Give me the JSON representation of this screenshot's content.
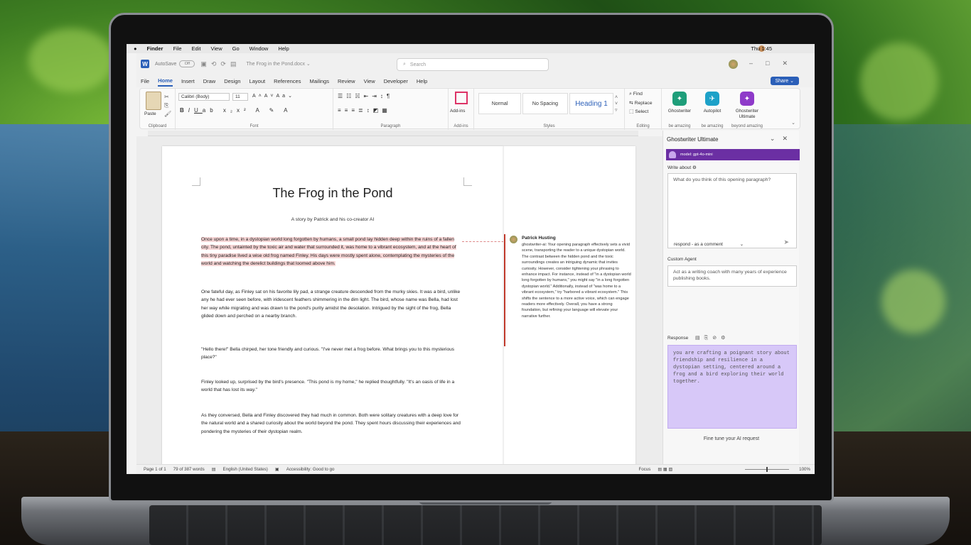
{
  "menubar": {
    "apple": "",
    "app": "Finder",
    "items": [
      "File",
      "Edit",
      "View",
      "Go",
      "Window",
      "Help"
    ],
    "clock": "Thu 1:45"
  },
  "titlebar": {
    "autosave": "AutoSave",
    "toggle": "Off",
    "doc_title": "The Frog in the Pond.docx ⌄",
    "search_placeholder": "Search"
  },
  "tabs": [
    "File",
    "Home",
    "Insert",
    "Draw",
    "Design",
    "Layout",
    "References",
    "Mailings",
    "Review",
    "View",
    "Developer",
    "Help"
  ],
  "share_label": "Share ⌄",
  "ribbon": {
    "paste_label": "Paste",
    "clipboard_label": "Clipboard",
    "font_name": "Calibri (Body)",
    "font_size": "11",
    "font_label": "Font",
    "paragraph_label": "Paragraph",
    "addins_btn": "Add-ins",
    "addins_label": "Add-ins",
    "styles": [
      "Normal",
      "No Spacing",
      "Heading 1"
    ],
    "styles_label": "Styles",
    "find": "Find",
    "replace": "Replace",
    "select": "Select",
    "editing_label": "Editing",
    "addins": [
      {
        "name": "Ghostwriter",
        "group": "be amazing",
        "color": "#1e9e7a"
      },
      {
        "name": "Autopilot",
        "group": "be amazing",
        "color": "#1da1c8"
      },
      {
        "name": "Ghostwriter Ultimate",
        "group": "beyond amazing",
        "color": "#8e3ac9"
      }
    ]
  },
  "document": {
    "title": "The Frog in the Pond",
    "subtitle": "A story by Patrick and his co-creator AI",
    "paragraphs": [
      "Once upon a time, in a dystopian world long forgotten by humans, a small pond lay hidden deep within the ruins of a fallen city. The pond, untainted by the toxic air and water that surrounded it, was home to a vibrant ecosystem, and at the heart of this tiny paradise lived a wise old frog named Finley. His days were mostly spent alone, contemplating the mysteries of the world and watching the derelict buildings that loomed above him.",
      "One fateful day, as Finley sat on his favorite lily pad, a strange creature descended from the murky skies. It was a bird, unlike any he had ever seen before, with iridescent feathers shimmering in the dim light. The bird, whose name was Bella, had lost her way while migrating and was drawn to the pond's purity amidst the desolation. Intrigued by the sight of the frog, Bella glided down and perched on a nearby branch.",
      "\"Hello there!\" Bella chirped, her tone friendly and curious. \"I've never met a frog before. What brings you to this mysterious place?\"",
      "Finley looked up, surprised by the bird's presence. \"This pond is my home,\" he replied thoughtfully. \"It's an oasis of life in a world that has lost its way.\"",
      "As they conversed, Bella and Finley discovered they had much in common. Both were solitary creatures with a deep love for the natural world and a shared curiosity about the world beyond the pond. They spent hours discussing their experiences and pondering the mysteries of their dystopian realm."
    ]
  },
  "comment": {
    "author": "Patrick Husting",
    "text": "ghostwriter-ai: Your opening paragraph effectively sets a vivid scene, transporting the reader to a unique dystopian world. The contrast between the hidden pond and the toxic surroundings creates an intriguing dynamic that invites curiosity. However, consider tightening your phrasing to enhance impact. For instance, instead of \"in a dystopian world long forgotten by humans,\" you might say \"in a long forgotten dystopian world.\" Additionally, instead of \"was home to a vibrant ecosystem,\" try \"harbored a vibrant ecosystem.\" This shifts the sentence to a more active voice, which can engage readers more effectively. Overall, you have a strong foundation, but refining your language will elevate your narrative further."
  },
  "status": {
    "page": "Page 1 of 1",
    "words": "79 of 387 words",
    "lang": "English (United States)",
    "access": "Accessibility: Good to go",
    "focus": "Focus",
    "zoom": "100%"
  },
  "pane": {
    "title": "Ghostwriter Ultimate",
    "model": "model: gpt-4o-mini",
    "write_label": "Write about",
    "write_text": "What do you think of this opening paragraph?",
    "mode": "respond - as a comment",
    "agent_label": "Custom Agent",
    "agent_text": "Act as a writing coach with many years of experience publishing books.",
    "response_label": "Response",
    "response_text": "you are crafting a poignant story about friendship and resilience in a dystopian setting, centered around a frog and a bird exploring their world together.",
    "fine_tune": "Fine tune your AI request"
  }
}
